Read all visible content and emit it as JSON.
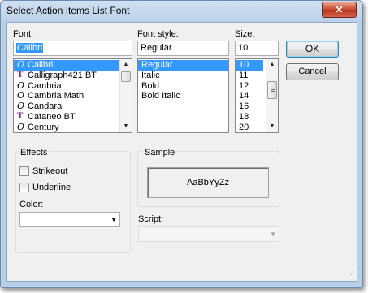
{
  "dialog": {
    "title": "Select Action Items List Font",
    "close_label": "✕"
  },
  "font": {
    "label": "Font:",
    "value": "Calibri",
    "items": [
      {
        "name": "Calibri",
        "icon": "opentype-font-icon",
        "selected": true
      },
      {
        "name": "Calligraph421 BT",
        "icon": "truetype-font-icon"
      },
      {
        "name": "Cambria",
        "icon": "opentype-font-icon"
      },
      {
        "name": "Cambria Math",
        "icon": "opentype-font-icon"
      },
      {
        "name": "Candara",
        "icon": "opentype-font-icon"
      },
      {
        "name": "Cataneo BT",
        "icon": "truetype-font-icon"
      },
      {
        "name": "Century",
        "icon": "opentype-font-icon"
      }
    ]
  },
  "style": {
    "label": "Font style:",
    "value": "Regular",
    "items": [
      "Regular",
      "Italic",
      "Bold",
      "Bold Italic"
    ]
  },
  "size": {
    "label": "Size:",
    "value": "10",
    "items": [
      "10",
      "11",
      "12",
      "14",
      "16",
      "18",
      "20"
    ]
  },
  "buttons": {
    "ok": "OK",
    "cancel": "Cancel"
  },
  "effects": {
    "label": "Effects",
    "strikeout": "Strikeout",
    "underline": "Underline",
    "color_label": "Color:",
    "color_value": ""
  },
  "sample": {
    "label": "Sample",
    "text": "AaBbYyZz"
  },
  "script": {
    "label": "Script:",
    "value": ""
  }
}
